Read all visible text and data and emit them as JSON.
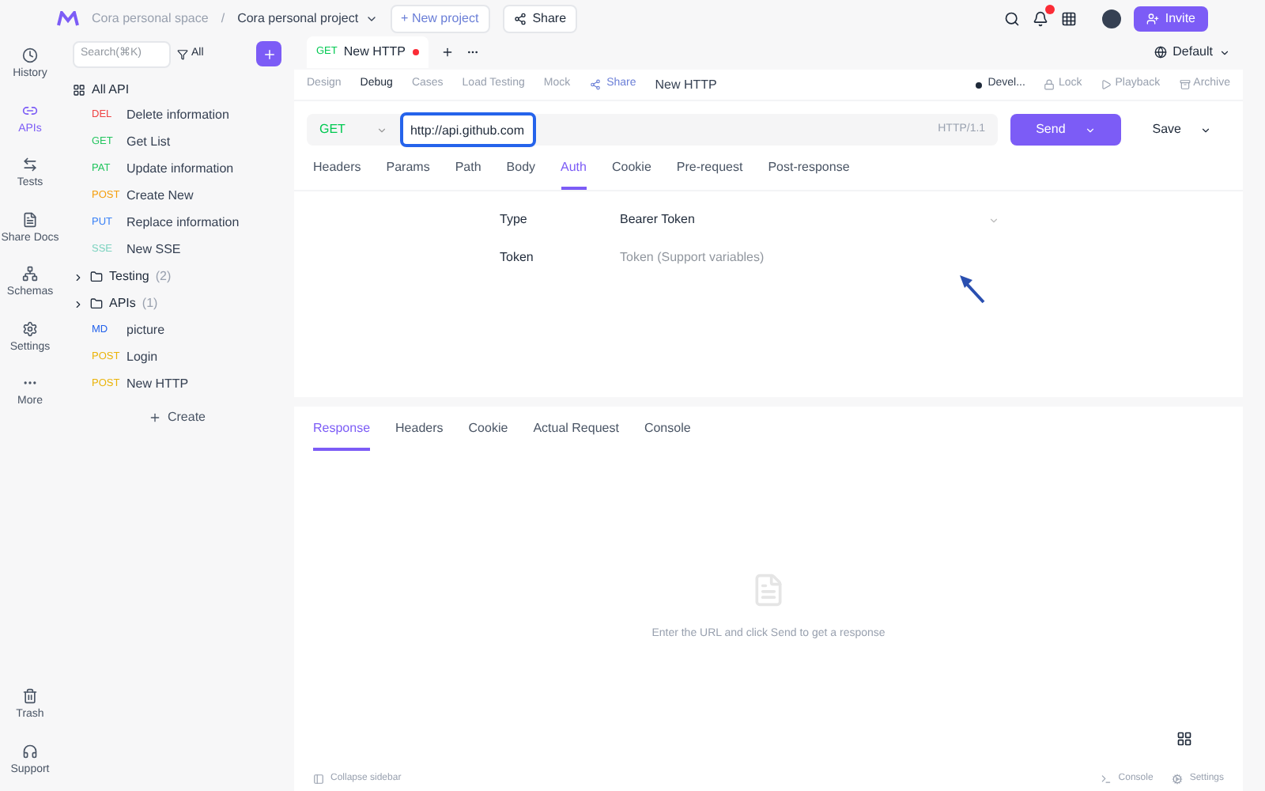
{
  "header": {
    "space": "Cora personal space",
    "separator": "/",
    "project": "Cora personal project",
    "new_project": "+ New project",
    "share": "Share",
    "invite": "Invite"
  },
  "nav": [
    {
      "label": "History",
      "selected": false
    },
    {
      "label": "APIs",
      "selected": true
    },
    {
      "label": "Tests",
      "selected": false
    },
    {
      "label": "Share Docs",
      "selected": false
    },
    {
      "label": "Schemas",
      "selected": false
    },
    {
      "label": "Settings",
      "selected": false
    },
    {
      "label": "More",
      "selected": false
    }
  ],
  "nav_bottom": [
    "Trash",
    "Support"
  ],
  "tree": {
    "search": {
      "placeholder": "Search(⌘K)"
    },
    "filter": "All",
    "root": "All API",
    "create": "Create",
    "items": [
      {
        "kind": "api",
        "method": "DEL",
        "color": "#ef4444",
        "name": "Delete information"
      },
      {
        "kind": "api",
        "method": "GET",
        "color": "#22c55e",
        "name": "Get List"
      },
      {
        "kind": "api",
        "method": "PAT",
        "color": "#22c55e",
        "name": "Update information"
      },
      {
        "kind": "api",
        "method": "POST",
        "color": "#f59e0b",
        "name": "Create New"
      },
      {
        "kind": "api",
        "method": "PUT",
        "color": "#3b82f6",
        "name": "Replace information"
      },
      {
        "kind": "api",
        "method": "SSE",
        "color": "#7dd3c0",
        "name": "New SSE"
      },
      {
        "kind": "folder",
        "name": "Testing",
        "count": "(2)"
      },
      {
        "kind": "folder",
        "name": "APIs",
        "count": "(1)"
      },
      {
        "kind": "api",
        "method": "MD",
        "color": "#2563eb",
        "name": "picture"
      },
      {
        "kind": "api",
        "method": "POST",
        "color": "#eab308",
        "name": "Login"
      },
      {
        "kind": "api",
        "method": "POST",
        "color": "#eab308",
        "name": "New HTTP"
      }
    ]
  },
  "doc_tab": {
    "method": "GET",
    "title": "New HTTP",
    "modified": true
  },
  "environment": "Default",
  "mode_tabs": [
    {
      "label": "Design",
      "selected": false
    },
    {
      "label": "Debug",
      "selected": true
    },
    {
      "label": "Cases",
      "selected": false
    },
    {
      "label": "Load Testing",
      "selected": false
    },
    {
      "label": "Mock",
      "selected": false
    }
  ],
  "share": "Share",
  "api_name": "New HTTP",
  "status": "Devel...",
  "actions": [
    "Lock",
    "Playback",
    "Archive"
  ],
  "request": {
    "method": "GET",
    "url": "http://api.github.com",
    "protocol": "HTTP/1.1",
    "send": "Send",
    "save": "Save"
  },
  "param_tabs": [
    {
      "label": "Headers",
      "selected": false
    },
    {
      "label": "Params",
      "selected": false
    },
    {
      "label": "Path",
      "selected": false
    },
    {
      "label": "Body",
      "selected": false
    },
    {
      "label": "Auth",
      "selected": true
    },
    {
      "label": "Cookie",
      "selected": false
    },
    {
      "label": "Pre-request",
      "selected": false
    },
    {
      "label": "Post-response",
      "selected": false
    }
  ],
  "auth": {
    "type_label": "Type",
    "type_value": "Bearer Token",
    "token_label": "Token",
    "token_placeholder": "Token (Support variables)"
  },
  "response_tabs": [
    {
      "label": "Response",
      "selected": true
    },
    {
      "label": "Headers",
      "selected": false
    },
    {
      "label": "Cookie",
      "selected": false
    },
    {
      "label": "Actual Request",
      "selected": false
    },
    {
      "label": "Console",
      "selected": false
    }
  ],
  "empty_text": "Enter the URL and click Send to get a response",
  "footer": {
    "left": "Collapse sidebar",
    "right": [
      "Console",
      "Settings"
    ]
  }
}
